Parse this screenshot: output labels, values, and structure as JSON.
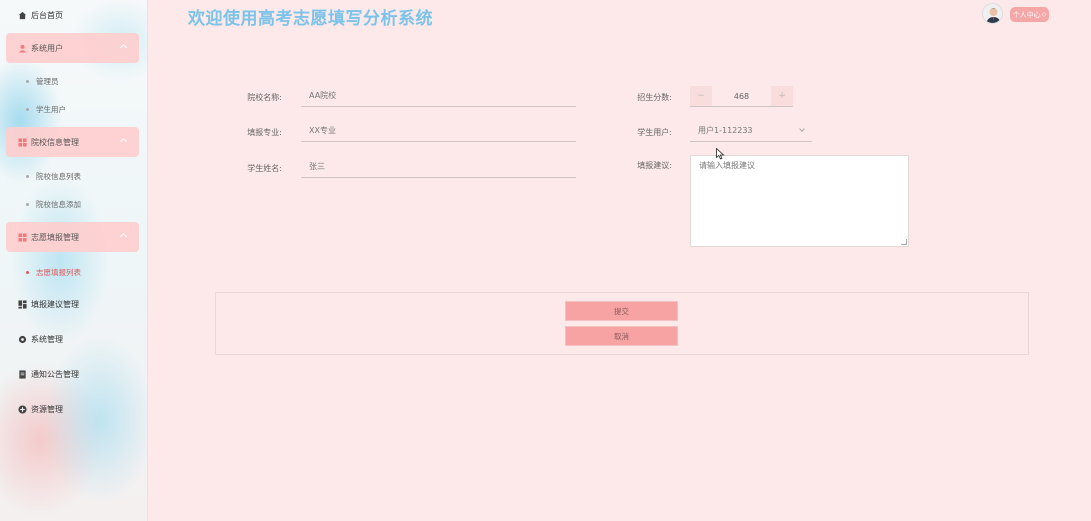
{
  "sidebar": {
    "items": [
      {
        "label": "后台首页"
      },
      {
        "label": "系统用户",
        "children": [
          {
            "label": "管理员"
          },
          {
            "label": "学生用户"
          }
        ]
      },
      {
        "label": "院校信息管理",
        "children": [
          {
            "label": "院校信息列表"
          },
          {
            "label": "院校信息添加"
          }
        ]
      },
      {
        "label": "志愿填报管理",
        "children": [
          {
            "label": "志愿填报列表"
          }
        ]
      },
      {
        "label": "填报建议管理"
      },
      {
        "label": "系统管理"
      },
      {
        "label": "通知公告管理"
      },
      {
        "label": "资源管理"
      }
    ]
  },
  "header": {
    "title": "欢迎使用高考志愿填写分析系统",
    "profile_label": "个人中心"
  },
  "form": {
    "school_name_label": "院校名称:",
    "school_name_value": "AA院校",
    "major_label": "填报专业:",
    "major_value": "XX专业",
    "student_name_label": "学生姓名:",
    "student_name_value": "张三",
    "score_label": "招生分数:",
    "score_value": "468",
    "score_minus": "−",
    "score_plus": "+",
    "student_user_label": "学生用户:",
    "student_user_value": "用户1-112233",
    "suggestion_label": "填报建议:",
    "suggestion_placeholder": "请输入填报建议"
  },
  "actions": {
    "submit_label": "提交",
    "cancel_label": "取消"
  },
  "colors": {
    "accent": "#f5a6a6",
    "title": "#7cc3ea",
    "active_menu": "#e05a5a",
    "background": "#fde9e9"
  }
}
